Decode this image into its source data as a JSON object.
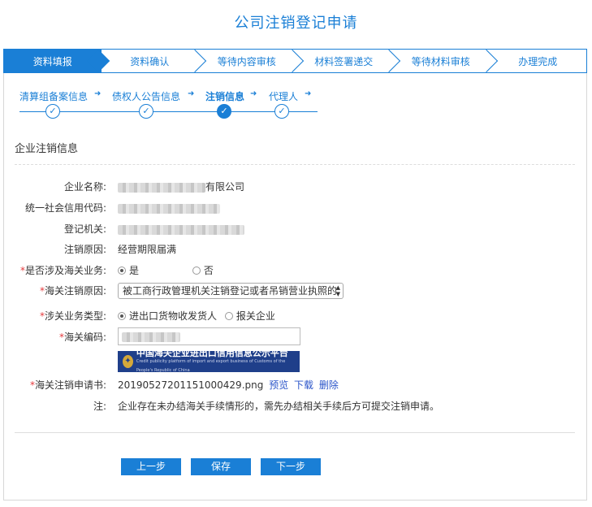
{
  "page_title": "公司注销登记申请",
  "steps": [
    "资料填报",
    "资料确认",
    "等待内容审核",
    "材料签署递交",
    "等待材料审核",
    "办理完成"
  ],
  "active_step": 0,
  "substeps": [
    "清算组备案信息",
    "债权人公告信息",
    "注销信息",
    "代理人"
  ],
  "current_substep": 2,
  "section_title": "企业注销信息",
  "fields": {
    "company_name": {
      "label": "企业名称:",
      "value_suffix": "有限公司"
    },
    "credit_code": {
      "label": "统一社会信用代码:"
    },
    "authority": {
      "label": "登记机关:"
    },
    "reason": {
      "label": "注销原因:",
      "value": "经营期限届满"
    },
    "customs_involved": {
      "label": "是否涉及海关业务:",
      "options": [
        "是",
        "否"
      ],
      "selected": 0
    },
    "customs_reason": {
      "label": "海关注销原因:",
      "value": "被工商行政管理机关注销登记或者吊销营业执照的"
    },
    "business_type": {
      "label": "涉关业务类型:",
      "options": [
        "进出口货物收发货人",
        "报关企业"
      ],
      "selected": 0
    },
    "customs_code": {
      "label": "海关编码:"
    },
    "application": {
      "label": "海关注销申请书:",
      "filename": "20190527201151000429.png",
      "actions": [
        "预览",
        "下载",
        "删除"
      ]
    },
    "note": {
      "label": "注:",
      "value": "企业存在未办结海关手续情形的，需先办结相关手续后方可提交注销申请。"
    }
  },
  "banner": {
    "title": "中国海关企业进出口信用信息公示平台",
    "subtitle": "Credit publicity platform of import and export business of Customs of the People's Republic of China"
  },
  "buttons": {
    "prev": "上一步",
    "save": "保存",
    "next": "下一步"
  },
  "required_mark": "*",
  "colors": {
    "primary": "#1a7fd6",
    "required": "#e4393c",
    "link": "#2b55c9"
  }
}
